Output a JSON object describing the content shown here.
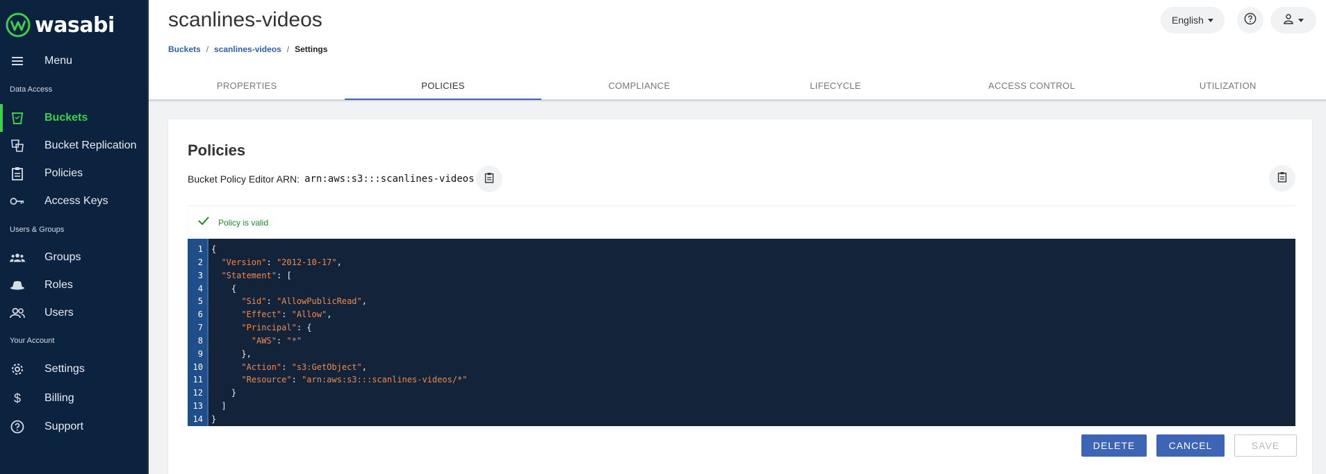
{
  "brand": {
    "name": "wasabi",
    "accent": "#3ecf4b",
    "sidebar_bg": "#0c2340"
  },
  "sidebar": {
    "menu_label": "Menu",
    "sections": [
      {
        "label": "Data Access"
      },
      {
        "label": "Users & Groups"
      },
      {
        "label": "Your Account"
      }
    ],
    "items": [
      {
        "label": "Buckets",
        "icon": "bucket-icon",
        "active": true
      },
      {
        "label": "Bucket Replication",
        "icon": "bucket-replication-icon"
      },
      {
        "label": "Policies",
        "icon": "clipboard-icon"
      },
      {
        "label": "Access Keys",
        "icon": "key-icon"
      },
      {
        "label": "Groups",
        "icon": "groups-icon"
      },
      {
        "label": "Roles",
        "icon": "hat-icon"
      },
      {
        "label": "Users",
        "icon": "users-icon"
      },
      {
        "label": "Settings",
        "icon": "gear-icon"
      },
      {
        "label": "Billing",
        "icon": "dollar-icon"
      },
      {
        "label": "Support",
        "icon": "help-circle-icon"
      }
    ]
  },
  "header": {
    "title": "scanlines-videos",
    "breadcrumb": [
      "Buckets",
      "scanlines-videos",
      "Settings"
    ],
    "language": "English"
  },
  "tabs": [
    {
      "label": "PROPERTIES"
    },
    {
      "label": "POLICIES",
      "active": true
    },
    {
      "label": "COMPLIANCE"
    },
    {
      "label": "LIFECYCLE"
    },
    {
      "label": "ACCESS CONTROL"
    },
    {
      "label": "UTILIZATION"
    }
  ],
  "policies": {
    "title": "Policies",
    "arn_label": "Bucket Policy Editor ARN:",
    "arn_value": "arn:aws:s3:::scanlines-videos",
    "status": "Policy is valid",
    "code_lines": [
      "{",
      "  \"Version\": \"2012-10-17\",",
      "  \"Statement\": [",
      "    {",
      "      \"Sid\": \"AllowPublicRead\",",
      "      \"Effect\": \"Allow\",",
      "      \"Principal\": {",
      "        \"AWS\": \"*\"",
      "      },",
      "      \"Action\": \"s3:GetObject\",",
      "      \"Resource\": \"arn:aws:s3:::scanlines-videos/*\"",
      "    }",
      "  ]",
      "}"
    ],
    "buttons": {
      "delete": "DELETE",
      "cancel": "CANCEL",
      "save": "SAVE"
    }
  }
}
